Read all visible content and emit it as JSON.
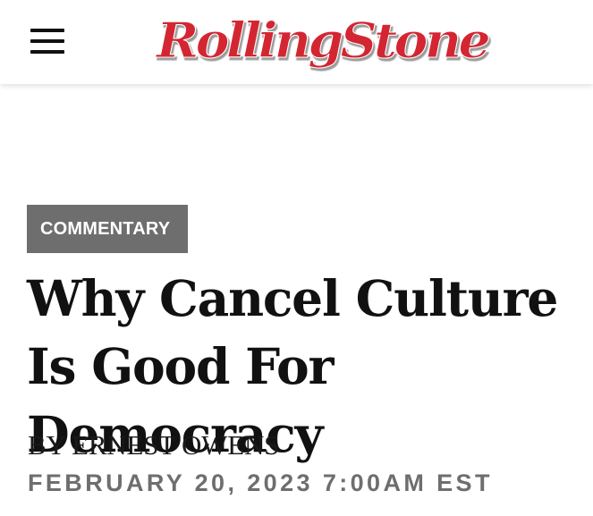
{
  "header": {
    "logo_text": "RollingStone",
    "menu_icon": "hamburger-menu-icon"
  },
  "article": {
    "category": "COMMENTARY",
    "title": "Why Cancel Culture Is Good For Democracy",
    "byline_prefix": "BY",
    "author": "ERNEST OWENS",
    "date": "FEBRUARY 20, 2023 7:00AM EST"
  },
  "colors": {
    "brand_red": "#d32531",
    "tag_background": "#6e6e6e",
    "headline": "#111111",
    "date_text": "#6e6e6e"
  }
}
